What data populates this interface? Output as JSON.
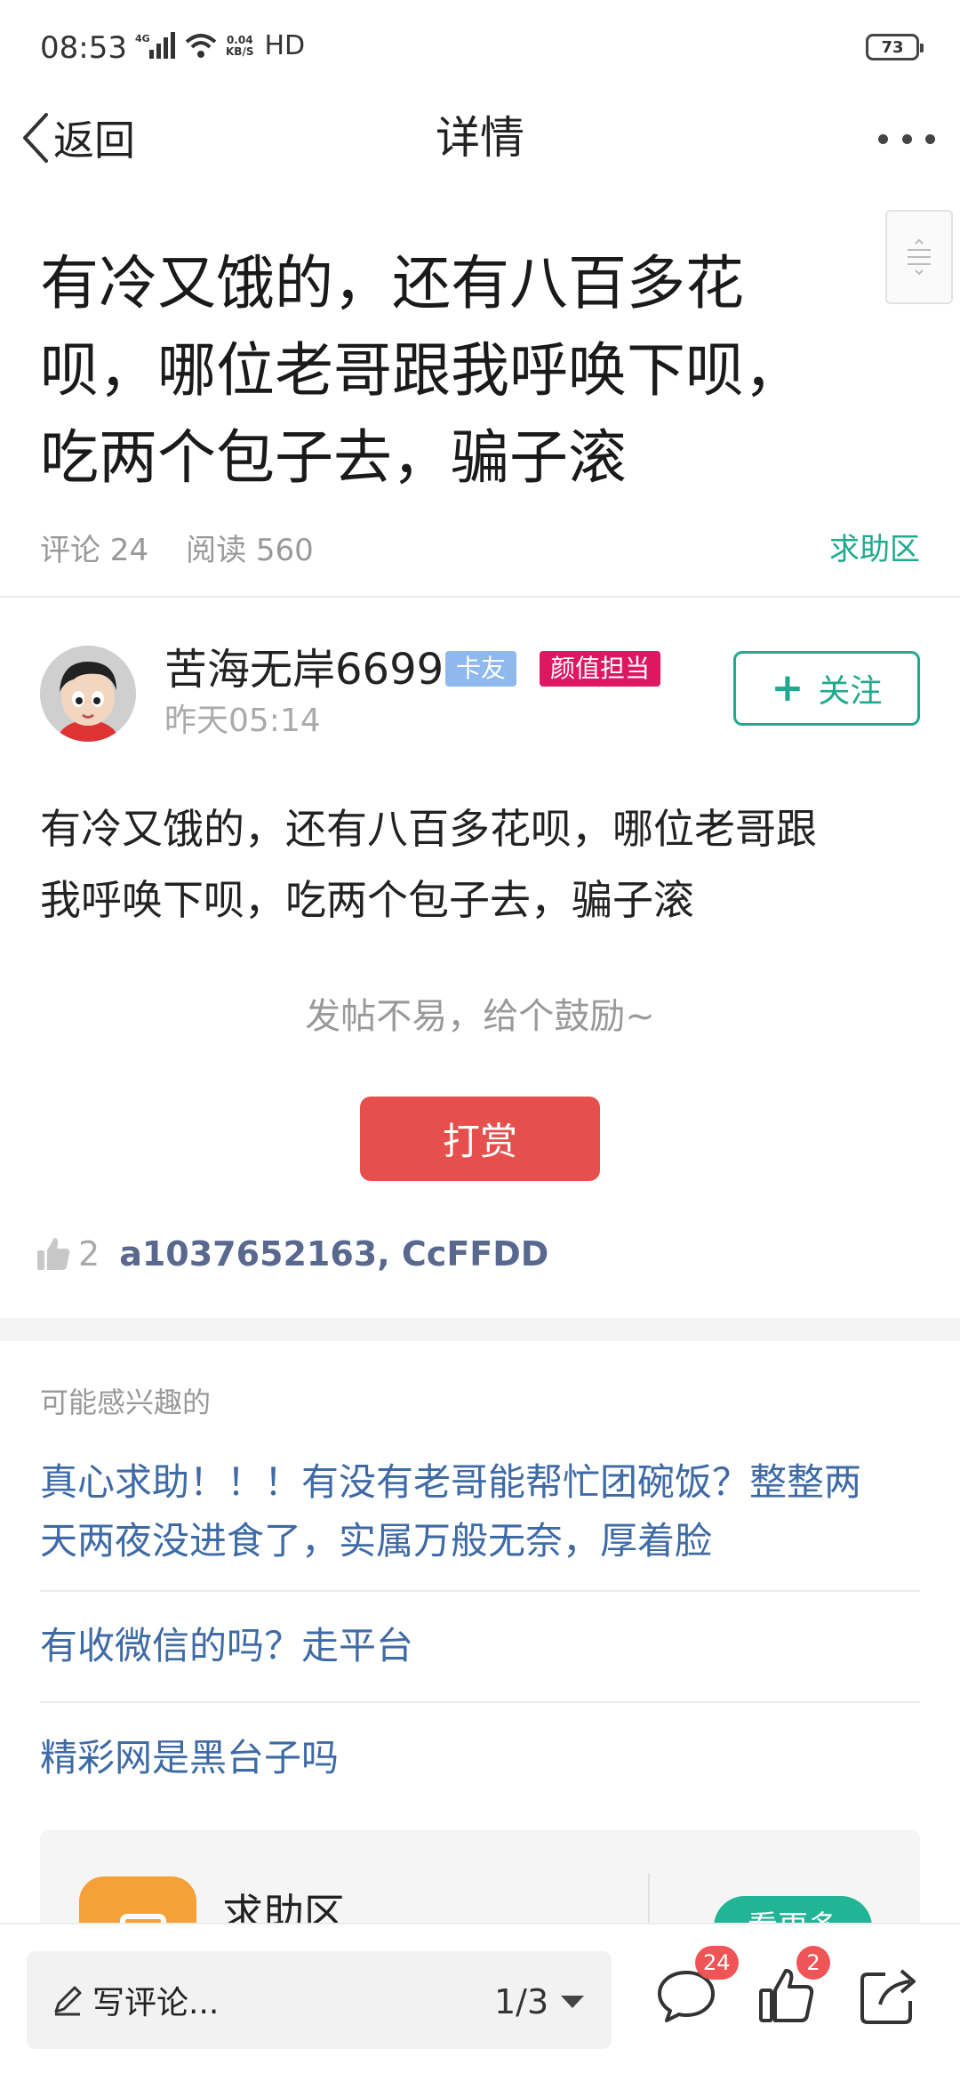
{
  "status_bar": {
    "time": "08:53",
    "network_type": "4G",
    "speed_value": "0.04",
    "speed_unit": "KB/S",
    "hd": "HD",
    "battery": "73"
  },
  "nav": {
    "back_label": "返回",
    "title": "详情"
  },
  "post": {
    "title_lines": [
      "有冷又饿的，还有八百多花",
      "呗，哪位老哥跟我呼唤下呗，",
      "吃两个包子去，骗子滚"
    ],
    "comments_label": "评论 24",
    "reads_label": "阅读 560",
    "board": "求助区",
    "body_lines": [
      "有冷又饿的，还有八百多花呗，哪位老哥跟",
      "我呼唤下呗，吃两个包子去，骗子滚"
    ],
    "encourage_text": "发帖不易，给个鼓励~",
    "reward_label": "打赏",
    "like_count": "2",
    "like_users": "a1037652163, CcFFDD"
  },
  "author": {
    "name": "苦海无岸6699",
    "badge_1": "卡友",
    "badge_2": "颜值担当",
    "time": "昨天05:14",
    "follow_label": "关注",
    "follow_plus": "+"
  },
  "recommend": {
    "heading": "可能感兴趣的",
    "items": [
      {
        "line1": "真心求助！！！有没有老哥能帮忙团碗饭？整整两",
        "line2": "天两夜没进食了，实属万般无奈，厚着脸"
      },
      {
        "line1": "有收微信的吗？走平台"
      },
      {
        "line1": "精彩网是黑台子吗"
      }
    ]
  },
  "board_card": {
    "name": "求助区",
    "button_label": "看更多"
  },
  "bottom_bar": {
    "comment_placeholder": "写评论...",
    "page_indicator": "1/3",
    "comment_count": "24",
    "like_count": "2"
  },
  "colors": {
    "accent": "#21a98f",
    "reward": "#e5504f",
    "link": "#3e6aa6",
    "badge_blue": "#8fb8ed",
    "badge_pink": "#dd1761",
    "count_badge": "#f05456"
  },
  "icons": [
    "back-chevron-icon",
    "more-dots-icon",
    "scroll-handle-icon",
    "thumb-up-icon",
    "pencil-icon",
    "dropdown-caret-icon",
    "comment-icon",
    "like-icon",
    "share-icon"
  ]
}
